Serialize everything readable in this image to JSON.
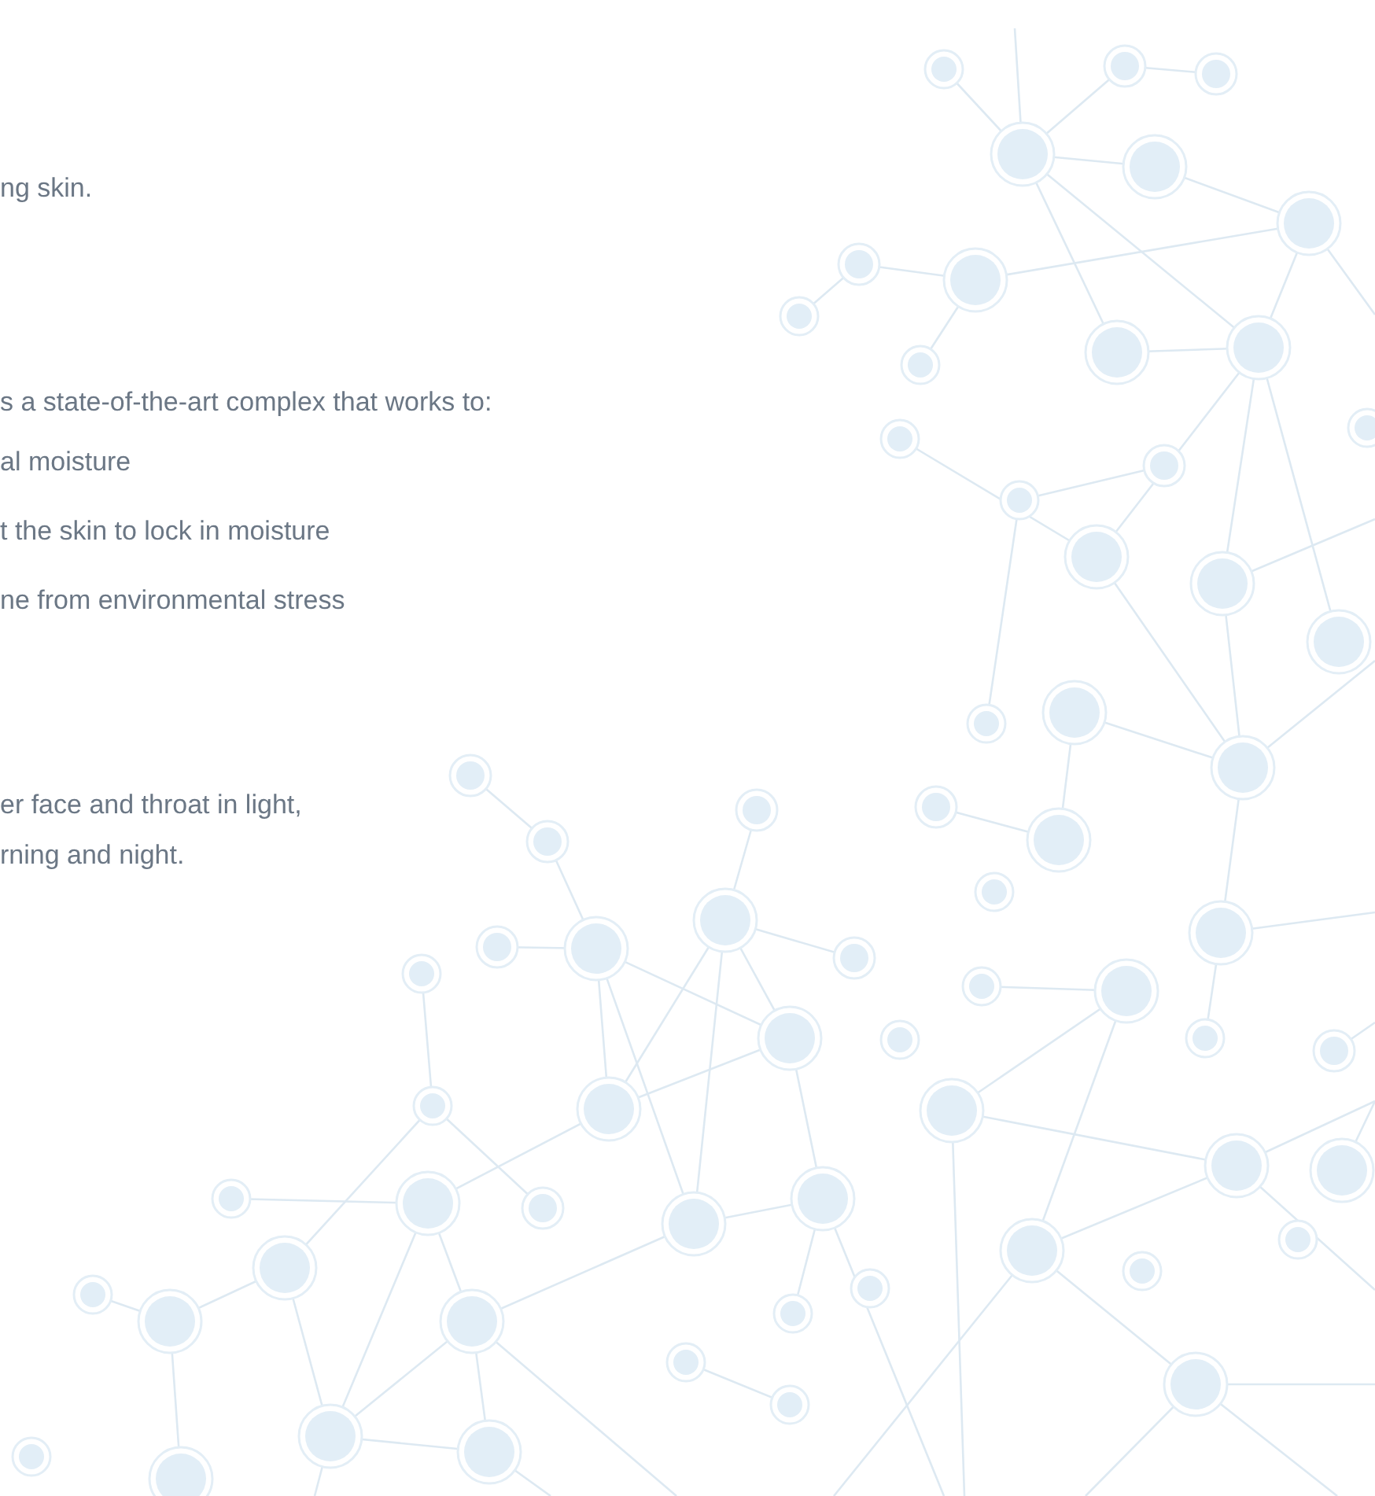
{
  "sections": [
    {
      "lines": [
        "ng skin."
      ]
    },
    {
      "lines": [
        "s a state-of-the-art complex that works to:"
      ],
      "items": [
        "al moisture",
        "t the skin to lock in moisture",
        "ne from environmental stress"
      ]
    },
    {
      "lines": [
        "er face and throat in light,",
        "rning and night."
      ]
    }
  ]
}
